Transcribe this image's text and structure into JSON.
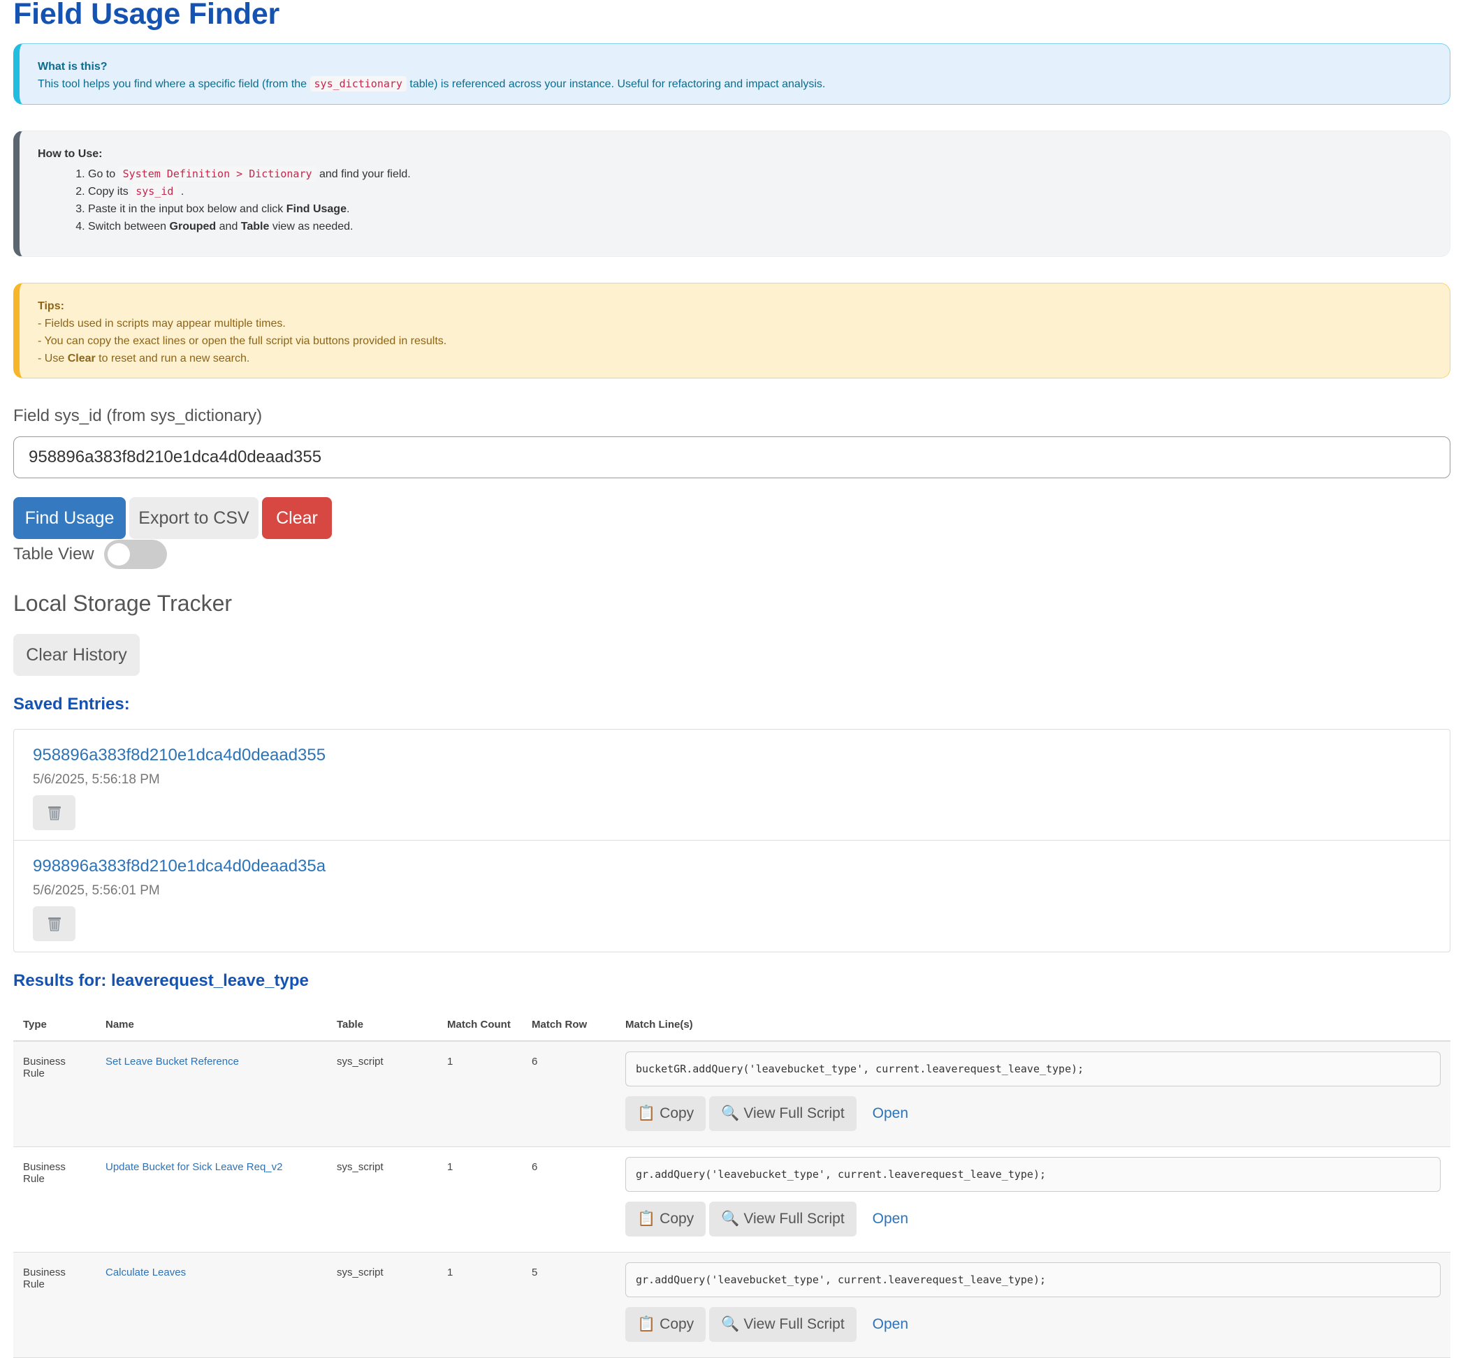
{
  "title": "Field Usage Finder",
  "info": {
    "heading": "What is this?",
    "text_before": "This tool helps you find where a specific field (from the",
    "code": "sys_dictionary",
    "text_after": "table) is referenced across your instance. Useful for refactoring and impact analysis."
  },
  "howto": {
    "heading": "How to Use:",
    "step1_before": "Go to",
    "step1_code": "System Definition > Dictionary",
    "step1_after": "and find your field.",
    "step2_before": "Copy its",
    "step2_code": "sys_id",
    "step2_after": ".",
    "step3_before": "Paste it in the input box below and click",
    "step3_bold": "Find Usage",
    "step3_after": ".",
    "step4_before": "Switch between",
    "step4_bold1": "Grouped",
    "step4_mid": "and",
    "step4_bold2": "Table",
    "step4_after": "view as needed."
  },
  "tips": {
    "heading": "Tips:",
    "line1": "- Fields used in scripts may appear multiple times.",
    "line2": "- You can copy the exact lines or open the full script via buttons provided in results.",
    "line3_before": "- Use",
    "line3_bold": "Clear",
    "line3_after": "to reset and run a new search."
  },
  "field": {
    "label": "Field sys_id (from sys_dictionary)",
    "value": "958896a383f8d210e1dca4d0deaad355"
  },
  "buttons": {
    "find": "Find Usage",
    "export": "Export to CSV",
    "clear": "Clear"
  },
  "toggle": {
    "label": "Table View",
    "on": false
  },
  "tracker": {
    "title": "Local Storage Tracker",
    "clear_history": "Clear History",
    "saved_title": "Saved Entries:",
    "entries": [
      {
        "id": "958896a383f8d210e1dca4d0deaad355",
        "date": "5/6/2025, 5:56:18 PM"
      },
      {
        "id": "998896a383f8d210e1dca4d0deaad35a",
        "date": "5/6/2025, 5:56:01 PM"
      }
    ]
  },
  "results": {
    "title": "Results for: leaverequest_leave_type",
    "headers": [
      "Type",
      "Name",
      "Table",
      "Match Count",
      "Match Row",
      "Match Line(s)"
    ],
    "copy_label": "Copy",
    "view_label": "View Full Script",
    "open_label": "Open",
    "rows": [
      {
        "type": "Business Rule",
        "name": "Set Leave Bucket Reference",
        "table": "sys_script",
        "count": "1",
        "row": "6",
        "line": "bucketGR.addQuery('leavebucket_type', current.leaverequest_leave_type);"
      },
      {
        "type": "Business Rule",
        "name": "Update Bucket for Sick Leave Req_v2",
        "table": "sys_script",
        "count": "1",
        "row": "6",
        "line": "gr.addQuery('leavebucket_type', current.leaverequest_leave_type);"
      },
      {
        "type": "Business Rule",
        "name": "Calculate Leaves",
        "table": "sys_script",
        "count": "1",
        "row": "5",
        "line": "gr.addQuery('leavebucket_type', current.leaverequest_leave_type);"
      }
    ]
  }
}
